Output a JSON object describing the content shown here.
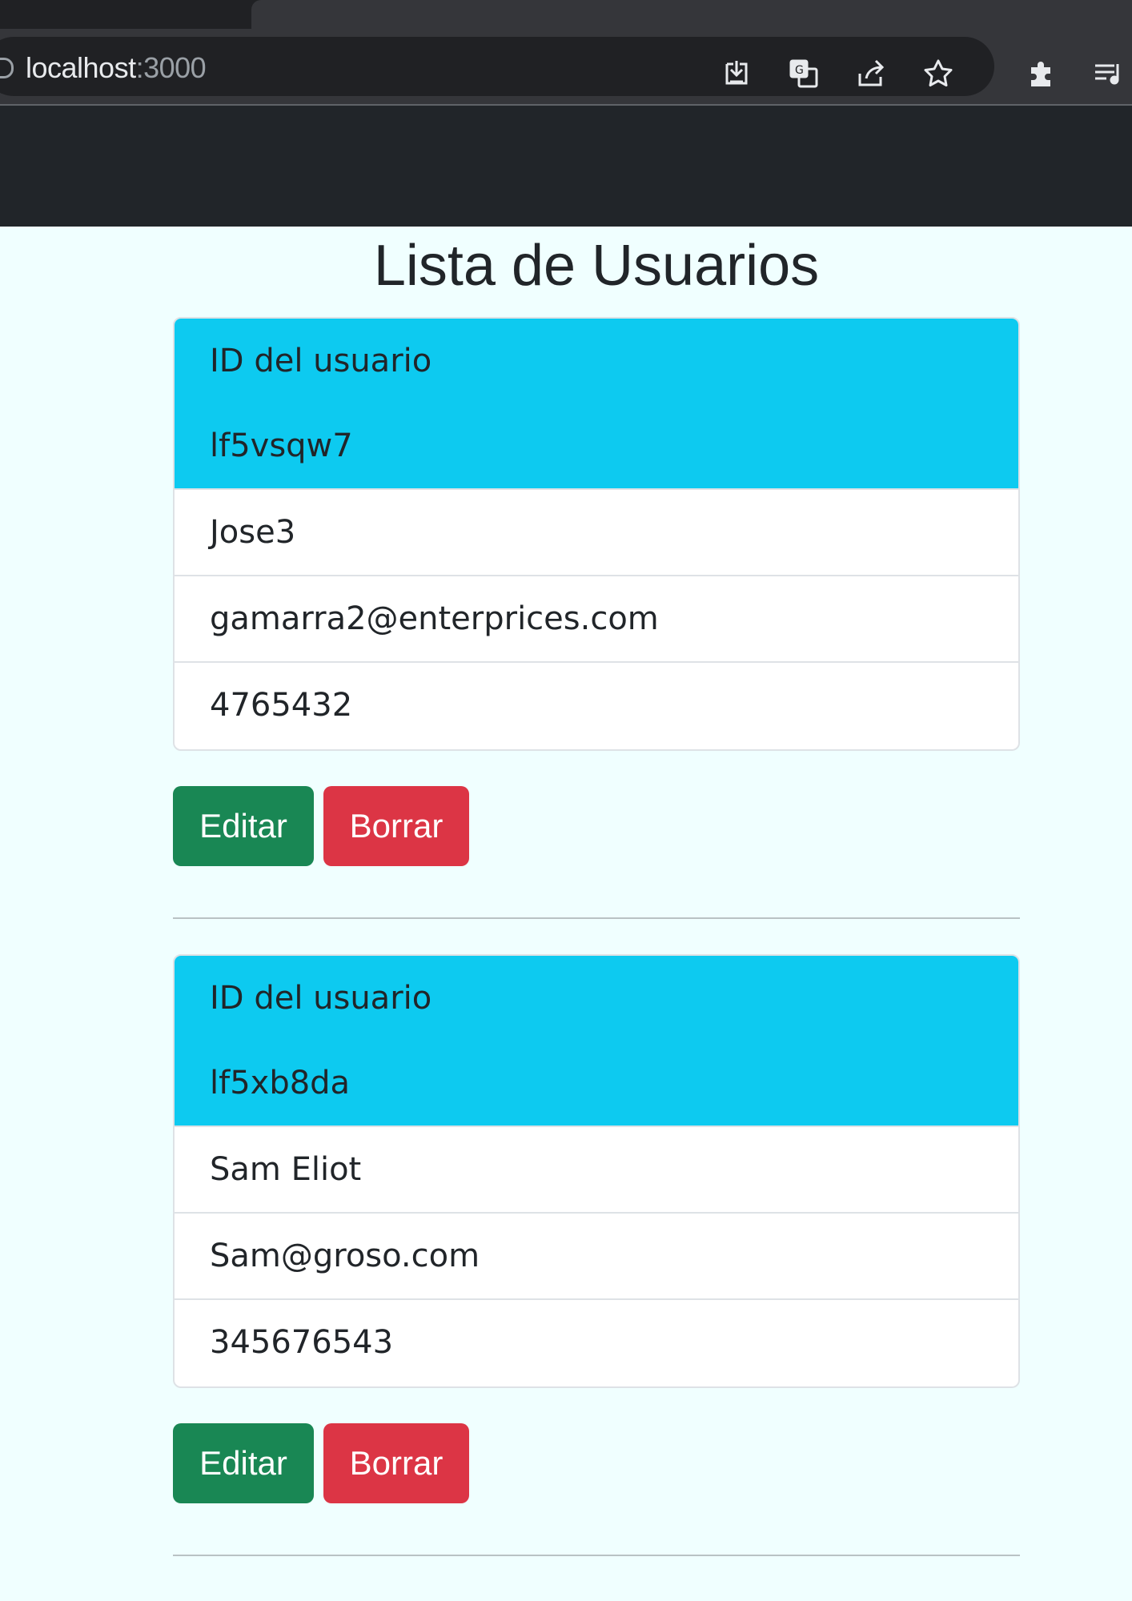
{
  "browser": {
    "url_host": "localhost",
    "url_port": ":3000"
  },
  "page": {
    "title": "Lista de Usuarios"
  },
  "users": [
    {
      "id_label": "ID del usuario",
      "id": "lf5vsqw7",
      "name": "Jose3",
      "email": "gamarra2@enterprices.com",
      "phone": "4765432",
      "edit_label": "Editar",
      "delete_label": "Borrar"
    },
    {
      "id_label": "ID del usuario",
      "id": "lf5xb8da",
      "name": "Sam Eliot",
      "email": "Sam@groso.com",
      "phone": "345676543",
      "edit_label": "Editar",
      "delete_label": "Borrar"
    }
  ],
  "colors": {
    "card_header": "#0dcaf0",
    "edit_button": "#198754",
    "delete_button": "#dc3545",
    "page_background": "#f0ffff",
    "navbar": "#212529"
  },
  "icons": [
    "install-icon",
    "translate-icon",
    "share-icon",
    "bookmark-star-icon",
    "extensions-icon",
    "reading-list-icon"
  ]
}
